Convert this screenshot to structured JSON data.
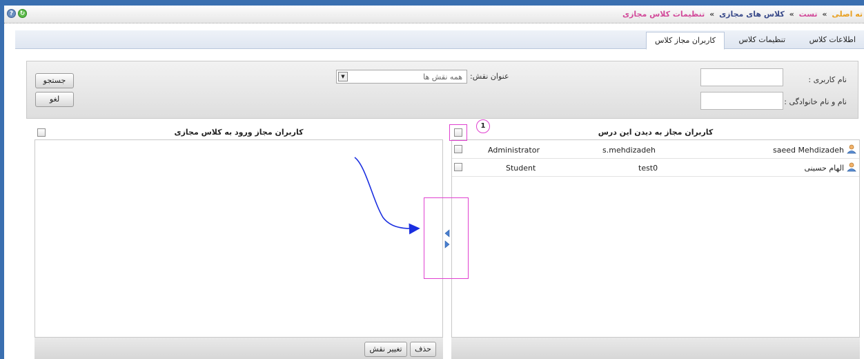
{
  "breadcrumb": {
    "home": "ته اصلی",
    "separator": "»",
    "item1": "تست",
    "item2": "کلاس های مجازی",
    "current": "تنظیمات کلاس مجازی"
  },
  "tabs": [
    {
      "label": "اطلاعات کلاس"
    },
    {
      "label": "تنظیمات کلاس"
    },
    {
      "label": "کاربران مجاز کلاس"
    }
  ],
  "search": {
    "username_label": "نام کاربری :",
    "username_value": "",
    "fullname_label": "نام و نام خانوادگی :",
    "fullname_value": "",
    "role_label": "عنوان نقش:",
    "role_selected": "همه نقش ها",
    "search_button": "جستجو",
    "cancel_button": "لغو"
  },
  "right_panel": {
    "title": "کاربران مجاز به دیدن این درس",
    "rows": [
      {
        "fullname": "saeed Mehdizadeh",
        "username": "s.mehdizadeh",
        "role": "Administrator"
      },
      {
        "fullname": "الهام حسینی",
        "username": "test0",
        "role": "Student"
      }
    ]
  },
  "left_panel": {
    "title": "کاربران مجاز ورود به کلاس مجازی",
    "rows": [],
    "delete_button": "حذف",
    "change_role_button": "تغییر نقش"
  },
  "annotation": {
    "badge_number": "1"
  },
  "colors": {
    "frame": "#3a6fb0",
    "highlight": "#e040d0",
    "arrow": "#1a2ee0",
    "breadcrumb_home": "#e8a020",
    "breadcrumb_link": "#d24a9a"
  }
}
